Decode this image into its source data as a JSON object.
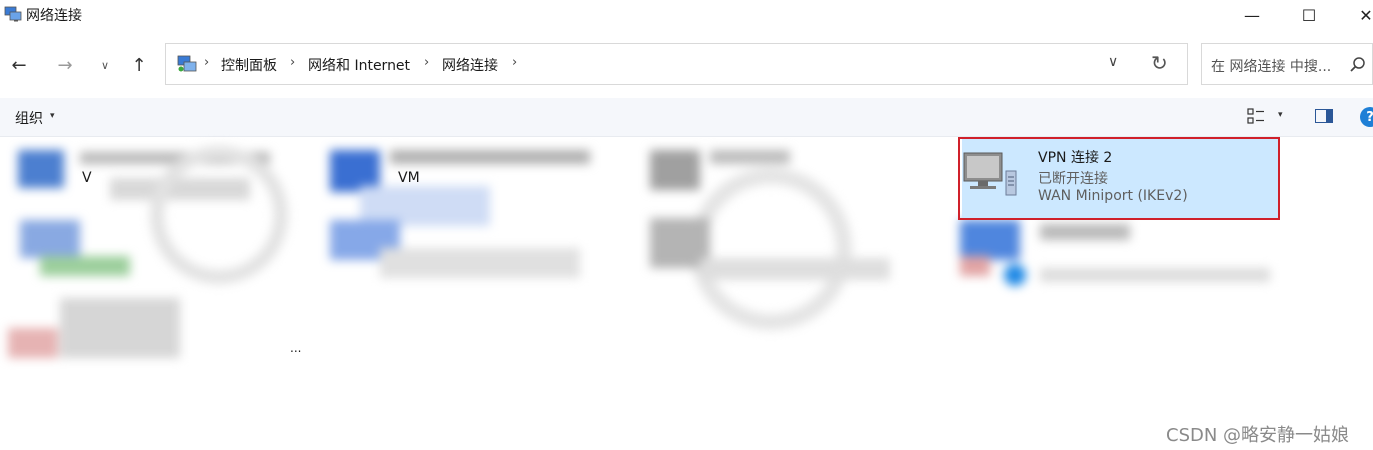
{
  "window": {
    "title": "网络连接",
    "minimize": "—",
    "maximize": "☐",
    "close": "✕"
  },
  "nav": {
    "back": "←",
    "forward": "→",
    "recent": "∨",
    "up": "↑"
  },
  "address": {
    "crumbs": [
      "控制面板",
      "网络和 Internet",
      "网络连接"
    ],
    "separator": "›",
    "dropdown": "∨",
    "refresh": "↻"
  },
  "search": {
    "placeholder": "在 网络连接 中搜...",
    "icon": "search-icon"
  },
  "commandbar": {
    "organize": "组织",
    "caret": "▾",
    "help": "?"
  },
  "connections": [
    {
      "name": "VPN 连接 2",
      "status": "已断开连接",
      "device": "WAN Miniport (IKEv2)",
      "selected": true
    }
  ],
  "blurred_fragments": {
    "frag1": "V",
    "frag2": "VM",
    "frag3": "..."
  },
  "watermark": "CSDN @略安静一姑娘",
  "colors": {
    "selection": "#cce8ff",
    "highlight_border": "#d0202a",
    "help_blue": "#1e7fd6"
  }
}
